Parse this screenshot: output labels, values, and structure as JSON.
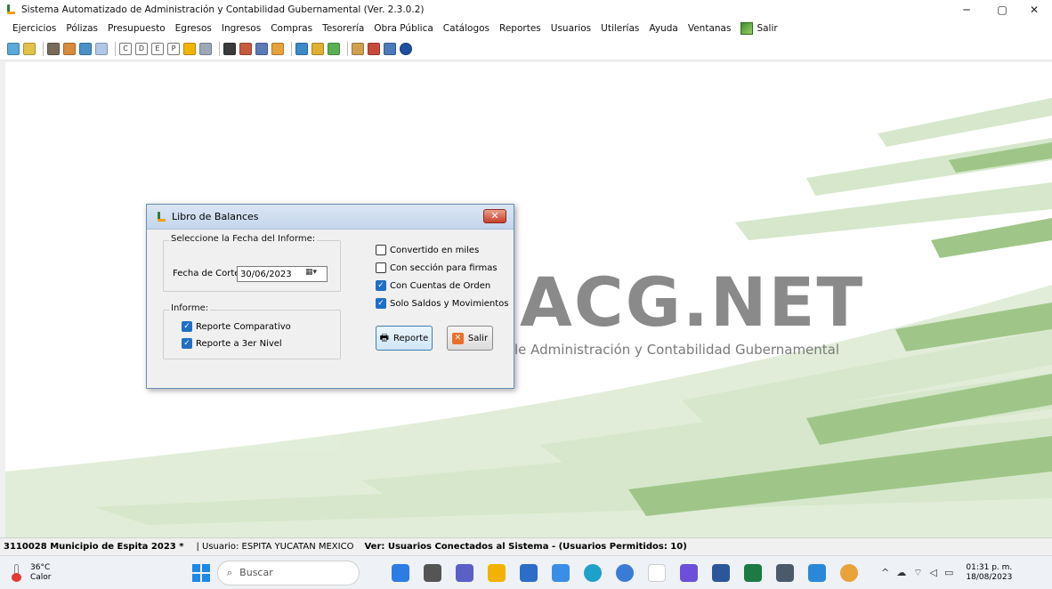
{
  "window": {
    "title": "Sistema Automatizado de Administración y Contabilidad Gubernamental (Ver. 2.3.0.2)",
    "controls": {
      "minimize": "─",
      "maximize": "▢",
      "close": "✕"
    }
  },
  "menu": {
    "items": [
      "Ejercicios",
      "Pólizas",
      "Presupuesto",
      "Egresos",
      "Ingresos",
      "Compras",
      "Tesorería",
      "Obra Pública",
      "Catálogos",
      "Reportes",
      "Usuarios",
      "Utilerías",
      "Ayuda",
      "Ventanas"
    ],
    "exit_label": "Salir"
  },
  "toolbar": {
    "letter_buttons": [
      "C",
      "D",
      "E",
      "P"
    ]
  },
  "background": {
    "logo_text": "ACG.NET",
    "logo_subtitle": "le Administración y Contabilidad Gubernamental"
  },
  "dialog": {
    "title": "Libro de Balances",
    "close_label": "✕",
    "date_group_label": "Seleccione la Fecha del Informe:",
    "date_label": "Fecha de Corte:",
    "date_value": "30/06/2023",
    "report_group_label": "Informe:",
    "report_options": [
      {
        "label": "Reporte Comparativo",
        "checked": true
      },
      {
        "label": "Reporte a 3er Nivel",
        "checked": true
      }
    ],
    "options": [
      {
        "label": "Convertido en miles",
        "checked": false
      },
      {
        "label": "Con sección para firmas",
        "checked": false
      },
      {
        "label": "Con Cuentas de Orden",
        "checked": true
      },
      {
        "label": "Solo Saldos y Movimientos",
        "checked": true
      }
    ],
    "report_button": "Reporte",
    "exit_button": "Salir"
  },
  "status": {
    "entity": "3110028 Municipio de Espita  2023  *",
    "user": "| Usuario: ESPITA YUCATAN MEXICO",
    "connected": "Ver: Usuarios Conectados al Sistema - (Usuarios Permitidos: 10)"
  },
  "taskbar": {
    "weather_temp": "36°C",
    "weather_desc": "Calor",
    "search_placeholder": "Buscar",
    "time": "01:31 p. m.",
    "date": "18/08/2023"
  },
  "colors": {
    "accent_green": "#8fbf70",
    "dialog_border": "#6b8fb8",
    "checkbox_blue": "#1f6fc5"
  }
}
